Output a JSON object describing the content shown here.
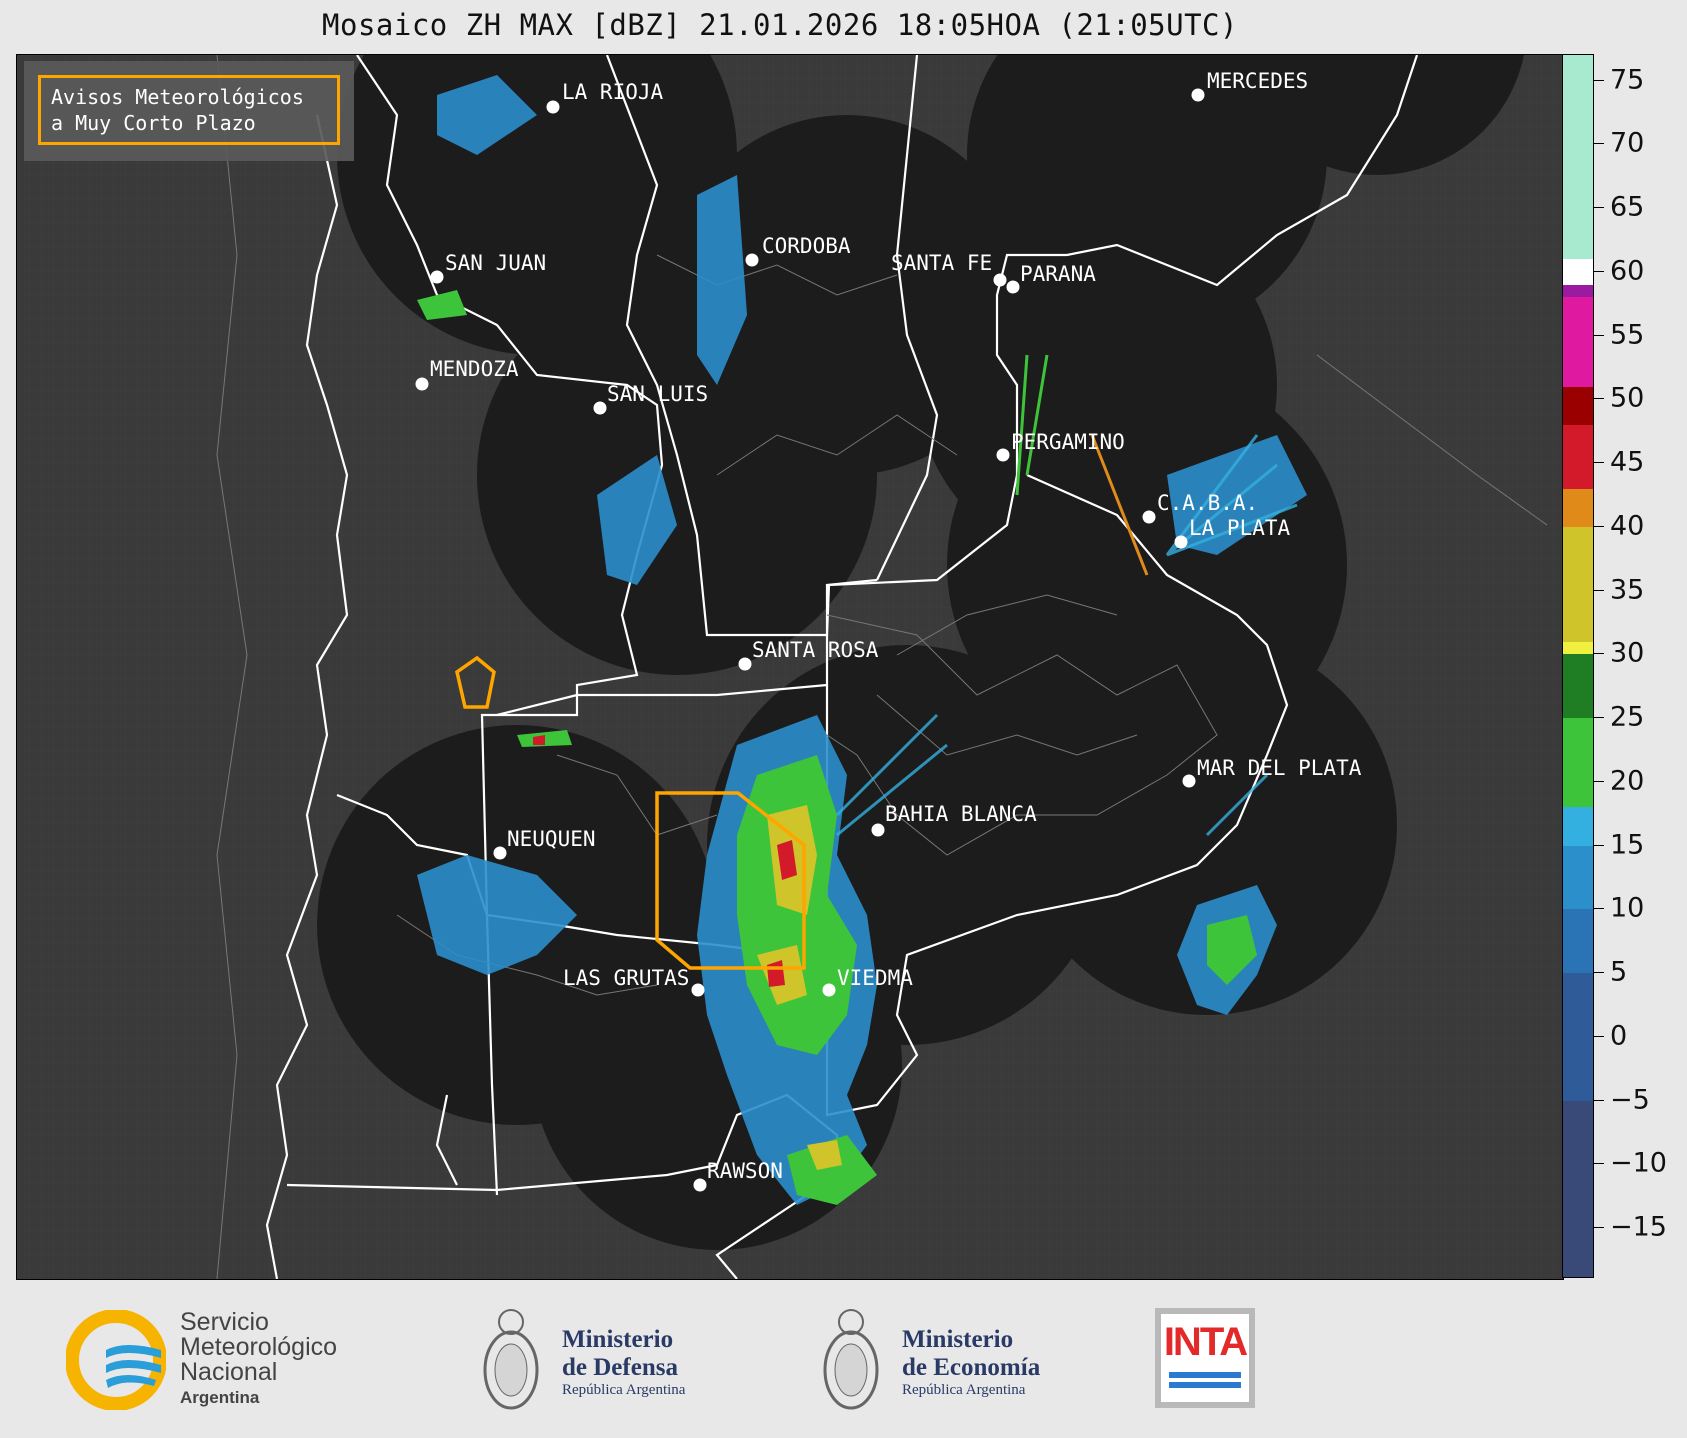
{
  "title": "Mosaico ZH MAX [dBZ] 21.01.2026 18:05HOA (21:05UTC)",
  "legend_box": {
    "line1": "Avisos Meteorológicos",
    "line2": "a Muy Corto Plazo",
    "border_color": "#ffa500"
  },
  "cities": [
    {
      "name": "LA RIOJA"
    },
    {
      "name": "MERCEDES"
    },
    {
      "name": "CORDOBA"
    },
    {
      "name": "SAN JUAN"
    },
    {
      "name": "SANTA FE"
    },
    {
      "name": "PARANA"
    },
    {
      "name": "MENDOZA"
    },
    {
      "name": "SAN LUIS"
    },
    {
      "name": "PERGAMINO"
    },
    {
      "name": "C.A.B.A."
    },
    {
      "name": "LA PLATA"
    },
    {
      "name": "SANTA ROSA"
    },
    {
      "name": "MAR DEL PLATA"
    },
    {
      "name": "BAHIA BLANCA"
    },
    {
      "name": "NEUQUEN"
    },
    {
      "name": "LAS GRUTAS"
    },
    {
      "name": "VIEDMA"
    },
    {
      "name": "RAWSON"
    }
  ],
  "colorbar": {
    "unit": "dBZ",
    "min": -19,
    "max": 77,
    "ticks": [
      "75",
      "70",
      "65",
      "60",
      "55",
      "50",
      "45",
      "40",
      "35",
      "30",
      "25",
      "20",
      "15",
      "10",
      "5",
      "0",
      "−5",
      "−10",
      "−15"
    ],
    "tick_values": [
      75,
      70,
      65,
      60,
      55,
      50,
      45,
      40,
      35,
      30,
      25,
      20,
      15,
      10,
      5,
      0,
      -5,
      -10,
      -15
    ],
    "bands": [
      {
        "from": -19,
        "to": -5,
        "color": "#3a4a78"
      },
      {
        "from": -5,
        "to": 5,
        "color": "#2f5c99"
      },
      {
        "from": 5,
        "to": 10,
        "color": "#2a74b6"
      },
      {
        "from": 10,
        "to": 15,
        "color": "#2b8fcc"
      },
      {
        "from": 15,
        "to": 18,
        "color": "#33b0e0"
      },
      {
        "from": 18,
        "to": 25,
        "color": "#3ec43a"
      },
      {
        "from": 25,
        "to": 30,
        "color": "#1f7d23"
      },
      {
        "from": 30,
        "to": 31,
        "color": "#f0f040"
      },
      {
        "from": 31,
        "to": 40,
        "color": "#cfc52a"
      },
      {
        "from": 40,
        "to": 43,
        "color": "#e08a1a"
      },
      {
        "from": 43,
        "to": 48,
        "color": "#d21a2a"
      },
      {
        "from": 48,
        "to": 51,
        "color": "#9a0000"
      },
      {
        "from": 51,
        "to": 58,
        "color": "#e01aa0"
      },
      {
        "from": 58,
        "to": 59,
        "color": "#9a1aa0"
      },
      {
        "from": 59,
        "to": 61,
        "color": "#ffffff"
      },
      {
        "from": 61,
        "to": 77,
        "color": "#a8ead0"
      }
    ]
  },
  "logos": {
    "smn": {
      "line1": "Servicio",
      "line2": "Meteorológico",
      "line3": "Nacional",
      "line4": "Argentina"
    },
    "defensa": {
      "line1": "Ministerio",
      "line2": "de Defensa",
      "line3": "República Argentina"
    },
    "economia": {
      "line1": "Ministerio",
      "line2": "de Economía",
      "line3": "República Argentina"
    },
    "inta": {
      "text": "INTA"
    }
  }
}
